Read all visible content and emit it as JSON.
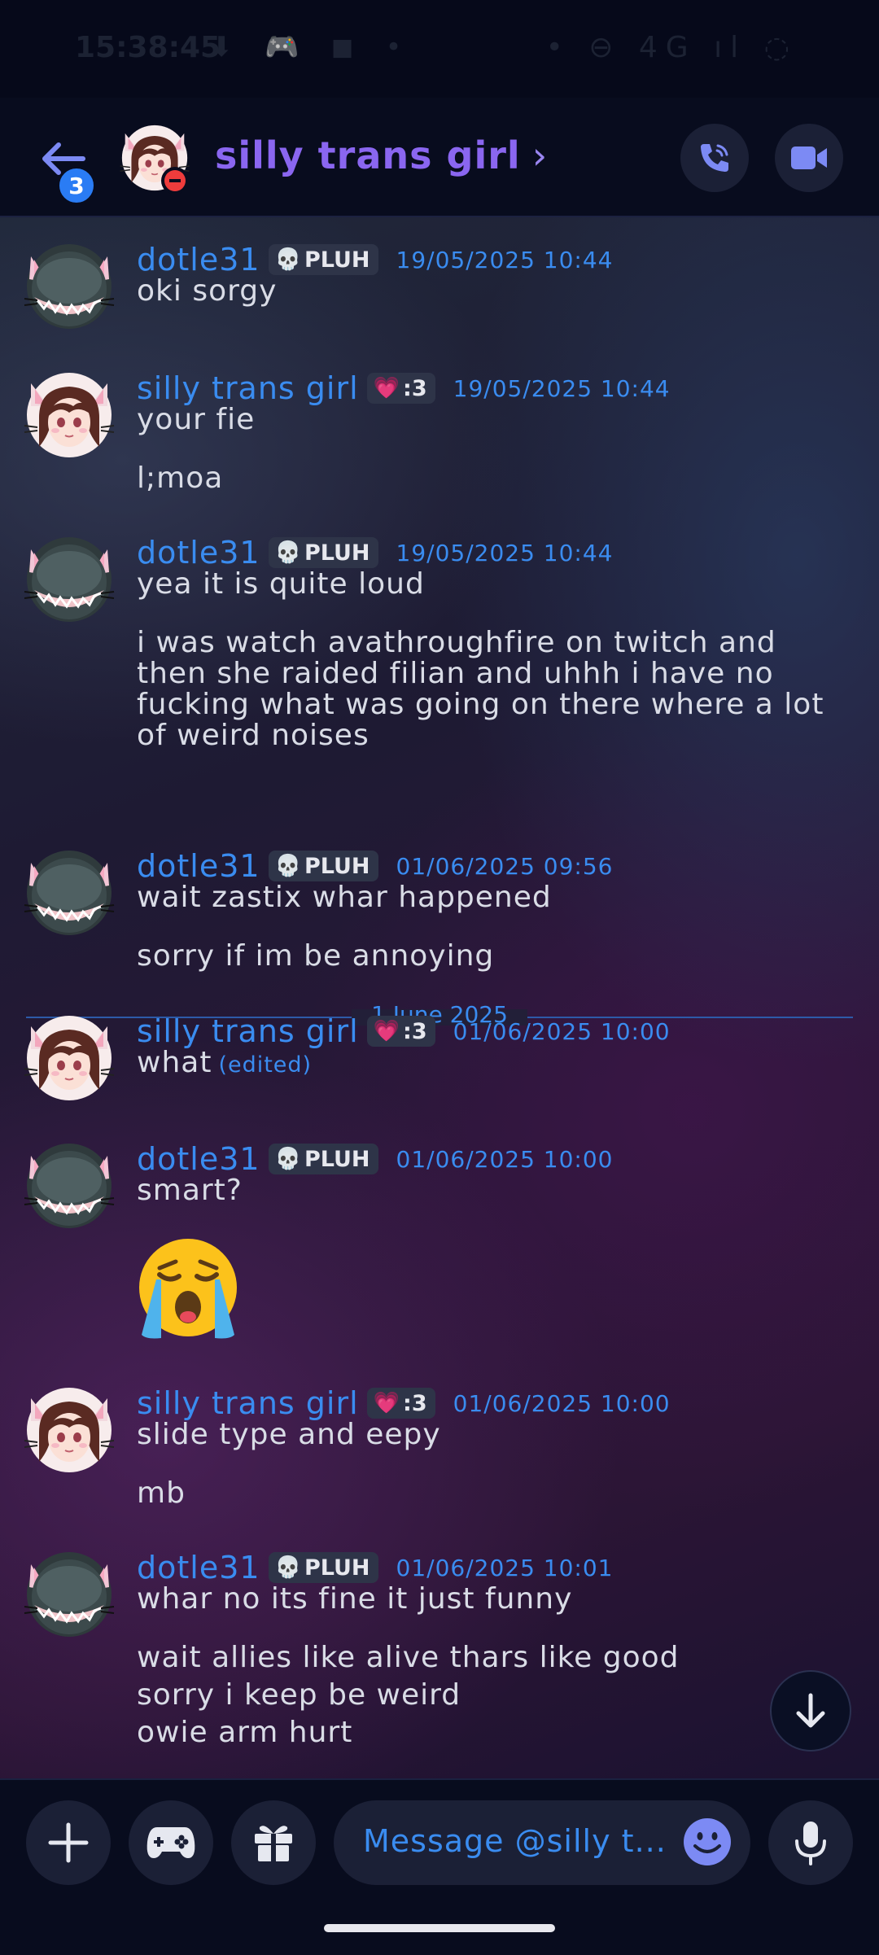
{
  "statusbar": {
    "time": "15:38:45",
    "left_icons": "⬇ 🎮 ◼ •",
    "right_icons": "• ⊖ 4G ıl ◌"
  },
  "header": {
    "back_badge": "3",
    "title": "silly trans girl",
    "chevron": "›",
    "call_icon": "phone-icon",
    "video_icon": "video-camera-icon"
  },
  "tags": {
    "dotle": {
      "icon": "💀",
      "text": "PLUH"
    },
    "silly": {
      "icon": "💗",
      "text": ":3"
    }
  },
  "messages": [
    {
      "author": "dotle31",
      "timestamp": "19/05/2025 10:44",
      "lines": [
        "oki sorgy"
      ]
    },
    {
      "author": "silly trans girl",
      "timestamp": "19/05/2025 10:44",
      "lines": [
        "your fie",
        "l;moa"
      ]
    },
    {
      "author": "dotle31",
      "timestamp": "19/05/2025 10:44",
      "lines": [
        "yea it is quite loud",
        "i was watch avathroughfire on twitch and",
        "then she raided filian and uhhh i have no",
        "fucking what was going on there where a lot",
        "of weird noises"
      ]
    },
    {
      "author": "dotle31",
      "timestamp": "01/06/2025 09:56",
      "lines": [
        "wait zastix whar happened",
        "sorry if im be annoying"
      ]
    },
    {
      "author": "silly trans girl",
      "timestamp": "01/06/2025 10:00",
      "lines": [
        "what"
      ],
      "edited": "(edited)"
    },
    {
      "author": "dotle31",
      "timestamp": "01/06/2025 10:00",
      "lines": [
        "smart?"
      ],
      "emoji": "loudly-crying-face-emoji"
    },
    {
      "author": "silly trans girl",
      "timestamp": "01/06/2025 10:00",
      "lines": [
        "slide type and eepy",
        "mb"
      ]
    },
    {
      "author": "dotle31",
      "timestamp": "01/06/2025 10:01",
      "lines": [
        "whar no its fine it just funny",
        "wait allies like alive thars like good",
        "sorry i keep be weird",
        "owie arm hurt"
      ]
    }
  ],
  "date_divider": "1 June 2025",
  "composer": {
    "placeholder": "Message @silly t...",
    "plus_icon": "plus-icon",
    "game_icon": "gamepad-icon",
    "gift_icon": "gift-icon",
    "emoji_icon": "emoji-icon",
    "mic_icon": "microphone-icon"
  },
  "colors": {
    "accent": "#3a8cf0",
    "title": "#8a66f0",
    "badge": "#2a7cf4",
    "dnd": "#ee3c3c"
  }
}
